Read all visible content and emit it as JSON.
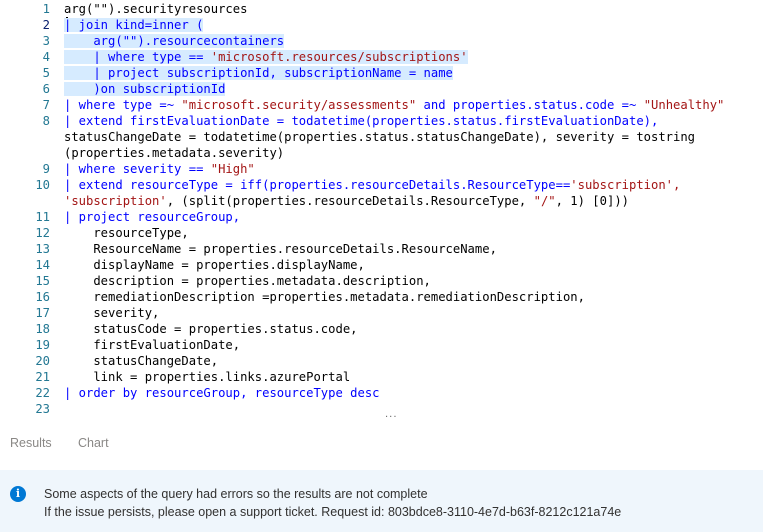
{
  "editor": {
    "active_line": 2,
    "lines": [
      {
        "num": "1",
        "segs": [
          {
            "t": "arg(\"\").securityresources",
            "c": "d"
          }
        ]
      },
      {
        "num": "2",
        "sel": true,
        "segs": [
          {
            "t": "| join kind=inner (",
            "c": "k"
          }
        ]
      },
      {
        "num": "3",
        "sel": true,
        "segs": [
          {
            "t": "    arg(\"\").resourcecontainers",
            "c": "k"
          }
        ]
      },
      {
        "num": "4",
        "sel": true,
        "segs": [
          {
            "t": "    | where type == ",
            "c": "k"
          },
          {
            "t": "'microsoft.resources/subscriptions'",
            "c": "s"
          }
        ]
      },
      {
        "num": "5",
        "sel": true,
        "segs": [
          {
            "t": "    | project subscriptionId, subscriptionName = name",
            "c": "k"
          }
        ]
      },
      {
        "num": "6",
        "sel": true,
        "segs": [
          {
            "t": "    )on subscriptionId",
            "c": "k"
          }
        ]
      },
      {
        "num": "7",
        "segs": [
          {
            "t": "| where type =~ ",
            "c": "k"
          },
          {
            "t": "\"microsoft.security/assessments\"",
            "c": "s"
          },
          {
            "t": " and properties.status.code =~ ",
            "c": "k"
          },
          {
            "t": "\"Unhealthy\"",
            "c": "s"
          }
        ]
      },
      {
        "num": "8",
        "segs": [
          {
            "t": "| extend firstEvaluationDate = todatetime(properties.status.firstEvaluationDate),",
            "c": "k"
          }
        ]
      },
      {
        "num": "",
        "segs": [
          {
            "t": "statusChangeDate = todatetime(properties.status.statusChangeDate), severity = tostring",
            "c": "d"
          }
        ]
      },
      {
        "num": "",
        "segs": [
          {
            "t": "(properties.metadata.severity)",
            "c": "d"
          }
        ]
      },
      {
        "num": "9",
        "segs": [
          {
            "t": "| where severity == ",
            "c": "k"
          },
          {
            "t": "\"High\"",
            "c": "s"
          }
        ]
      },
      {
        "num": "10",
        "segs": [
          {
            "t": "| extend resourceType = iff(properties.resourceDetails.ResourceType==",
            "c": "k"
          },
          {
            "t": "'subscription',",
            "c": "s"
          }
        ]
      },
      {
        "num": "",
        "segs": [
          {
            "t": "'subscription'",
            "c": "s"
          },
          {
            "t": ", (split(properties.resourceDetails.ResourceType, ",
            "c": "d"
          },
          {
            "t": "\"/\"",
            "c": "s"
          },
          {
            "t": ", 1) [0]))",
            "c": "d"
          }
        ]
      },
      {
        "num": "11",
        "segs": [
          {
            "t": "| project resourceGroup,",
            "c": "k"
          }
        ]
      },
      {
        "num": "12",
        "segs": [
          {
            "t": "    resourceType,",
            "c": "d"
          }
        ]
      },
      {
        "num": "13",
        "segs": [
          {
            "t": "    ResourceName = properties.resourceDetails.ResourceName,",
            "c": "d"
          }
        ]
      },
      {
        "num": "14",
        "segs": [
          {
            "t": "    displayName = properties.displayName,",
            "c": "d"
          }
        ]
      },
      {
        "num": "15",
        "segs": [
          {
            "t": "    description = properties.metadata.description,",
            "c": "d"
          }
        ]
      },
      {
        "num": "16",
        "segs": [
          {
            "t": "    remediationDescription =properties.metadata.remediationDescription,",
            "c": "d"
          }
        ]
      },
      {
        "num": "17",
        "segs": [
          {
            "t": "    severity,",
            "c": "d"
          }
        ]
      },
      {
        "num": "18",
        "segs": [
          {
            "t": "    statusCode = properties.status.code,",
            "c": "d"
          }
        ]
      },
      {
        "num": "19",
        "segs": [
          {
            "t": "    firstEvaluationDate,",
            "c": "d"
          }
        ]
      },
      {
        "num": "20",
        "segs": [
          {
            "t": "    statusChangeDate,",
            "c": "d"
          }
        ]
      },
      {
        "num": "21",
        "segs": [
          {
            "t": "    link = properties.links.azurePortal",
            "c": "d"
          }
        ]
      },
      {
        "num": "22",
        "segs": [
          {
            "t": "| order by resourceGroup, resourceType desc",
            "c": "k"
          }
        ]
      },
      {
        "num": "23",
        "segs": []
      }
    ],
    "overflow_indicator": "···"
  },
  "tabs": [
    {
      "label": "Results"
    },
    {
      "label": "Chart"
    }
  ],
  "banner": {
    "icon": "info-icon",
    "line1": "Some aspects of the query had errors so the results are not complete",
    "line2": "If the issue persists, please open a support ticket. Request id: 803bdce8-3110-4e7d-b63f-8212c121a74e"
  },
  "colors": {
    "keyword": "#0000ff",
    "string": "#a31515",
    "line_number": "#237893",
    "selection": "#d6ebff",
    "banner_bg": "#eff6fc",
    "info_icon": "#0078d4"
  }
}
